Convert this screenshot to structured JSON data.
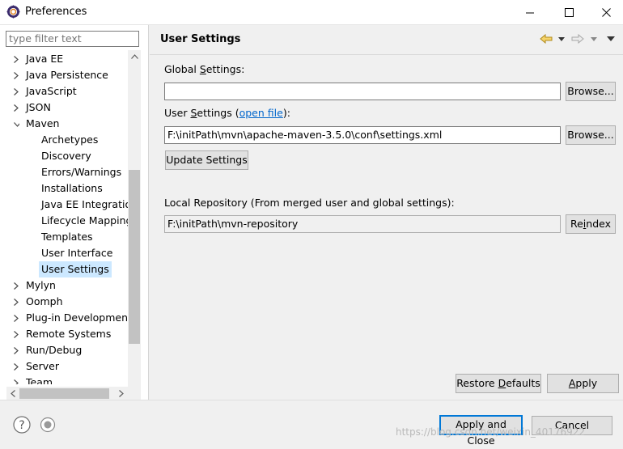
{
  "window": {
    "title": "Preferences",
    "minimize_glyph": "—",
    "maximize_glyph": "☐",
    "close_glyph": "✕"
  },
  "filter": {
    "placeholder": "type filter text"
  },
  "tree": {
    "items": [
      {
        "label": "Java EE",
        "level": 0,
        "state": "collapsed"
      },
      {
        "label": "Java Persistence",
        "level": 0,
        "state": "collapsed"
      },
      {
        "label": "JavaScript",
        "level": 0,
        "state": "collapsed"
      },
      {
        "label": "JSON",
        "level": 0,
        "state": "collapsed"
      },
      {
        "label": "Maven",
        "level": 0,
        "state": "expanded"
      },
      {
        "label": "Archetypes",
        "level": 1,
        "state": "leaf"
      },
      {
        "label": "Discovery",
        "level": 1,
        "state": "leaf"
      },
      {
        "label": "Errors/Warnings",
        "level": 1,
        "state": "leaf"
      },
      {
        "label": "Installations",
        "level": 1,
        "state": "leaf"
      },
      {
        "label": "Java EE Integration",
        "level": 1,
        "state": "leaf"
      },
      {
        "label": "Lifecycle Mappings",
        "level": 1,
        "state": "leaf"
      },
      {
        "label": "Templates",
        "level": 1,
        "state": "leaf"
      },
      {
        "label": "User Interface",
        "level": 1,
        "state": "leaf"
      },
      {
        "label": "User Settings",
        "level": 1,
        "state": "leaf",
        "selected": true
      },
      {
        "label": "Mylyn",
        "level": 0,
        "state": "collapsed"
      },
      {
        "label": "Oomph",
        "level": 0,
        "state": "collapsed"
      },
      {
        "label": "Plug-in Development",
        "level": 0,
        "state": "collapsed"
      },
      {
        "label": "Remote Systems",
        "level": 0,
        "state": "collapsed"
      },
      {
        "label": "Run/Debug",
        "level": 0,
        "state": "collapsed"
      },
      {
        "label": "Server",
        "level": 0,
        "state": "collapsed"
      },
      {
        "label": "Team",
        "level": 0,
        "state": "collapsed"
      }
    ]
  },
  "page": {
    "title": "User Settings",
    "global_label_prefix": "Global ",
    "global_label_mnemonic": "S",
    "global_label_suffix": "ettings:",
    "global_value": "",
    "global_browse": "Browse...",
    "user_label_prefix": "User ",
    "user_label_mnemonic": "S",
    "user_label_mid": "ettings (",
    "user_open_file": "open file",
    "user_label_suffix": "):",
    "user_value": "F:\\initPath\\mvn\\apache-maven-3.5.0\\conf\\settings.xml",
    "user_browse": "Browse...",
    "update_settings": "Update Settings",
    "local_repo_label": "Local Repository (From merged user and global settings):",
    "local_repo_value": "F:\\initPath\\mvn-repository",
    "reindex_prefix": "Re",
    "reindex_mnemonic": "i",
    "reindex_suffix": "ndex",
    "restore_prefix": "Restore ",
    "restore_mnemonic": "D",
    "restore_suffix": "efaults",
    "apply_mnemonic": "A",
    "apply_suffix": "pply"
  },
  "footer": {
    "help_glyph": "?",
    "apply_and_close": "Apply and Close",
    "cancel": "Cancel"
  },
  "watermark": "https://blog.csdn.net/weixin_40176922",
  "colors": {
    "selection": "#cce8ff",
    "accent": "#0078d7",
    "link": "#0066cc"
  }
}
